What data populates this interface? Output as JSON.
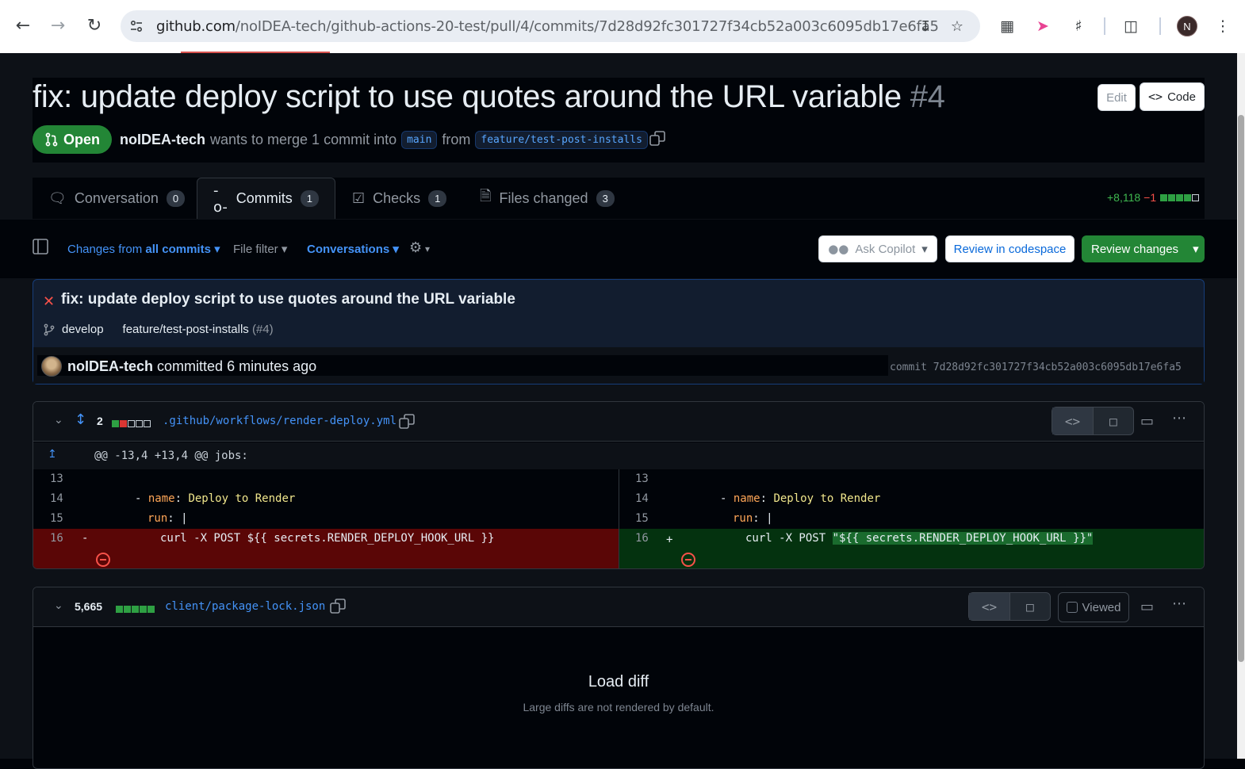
{
  "browser": {
    "url_host": "github.com",
    "url_path": "/noIDEA-tech/github-actions-20-test/pull/4/commits/7d28d92fc301727f34cb52a003c6095db17e6fa5",
    "profile_initial": "N"
  },
  "pr": {
    "title": "fix: update deploy script to use quotes around the URL variable",
    "number": "#4",
    "edit_label": "Edit",
    "code_label": "Code",
    "state": "Open",
    "author": "noIDEA-tech",
    "merge_text": "wants to merge 1 commit into",
    "base_branch": "main",
    "from_text": "from",
    "head_branch": "feature/test-post-installs"
  },
  "tabs": [
    {
      "label": "Conversation",
      "count": "0",
      "icon": "comment-discussion-icon"
    },
    {
      "label": "Commits",
      "count": "1",
      "icon": "git-commit-icon"
    },
    {
      "label": "Checks",
      "count": "1",
      "icon": "checklist-icon"
    },
    {
      "label": "Files changed",
      "count": "3",
      "icon": "file-diff-icon"
    }
  ],
  "diffstat": {
    "additions": "+8,118",
    "deletions": "−1"
  },
  "toolbar": {
    "changes_from": "Changes from",
    "all_commits": "all commits",
    "file_filter": "File filter",
    "conversations": "Conversations",
    "ask_copilot": "Ask Copilot",
    "review_codespace": "Review in codespace",
    "review_changes": "Review changes"
  },
  "commit": {
    "title": "fix: update deploy script to use quotes around the URL variable",
    "branch1": "develop",
    "branch2": "feature/test-post-installs",
    "pr_ref": "(#4)",
    "author": "noIDEA-tech",
    "committed": "committed",
    "time": "6 minutes ago",
    "sha_label": "commit 7d28d92fc301727f34cb52a003c6095db17e6fa5"
  },
  "file1": {
    "count": "2",
    "path": ".github/workflows/render-deploy.yml",
    "hunk": "@@ -13,4 +13,4 @@ jobs:",
    "left": {
      "lines": [
        "13",
        "14",
        "15",
        "16"
      ],
      "dash": "-",
      "name_key": "name",
      "name_val": "Deploy to Render",
      "run_key": "run",
      "pipe": "|",
      "del_sign": "-",
      "del_code": "curl -X POST ${{ secrets.RENDER_DEPLOY_HOOK_URL }}"
    },
    "right": {
      "lines": [
        "13",
        "14",
        "15",
        "16"
      ],
      "add_sign": "+",
      "add_code_prefix": "curl -X POST ",
      "add_code_str": "\"${{ secrets.RENDER_DEPLOY_HOOK_URL }}\""
    }
  },
  "file2": {
    "count": "5,665",
    "path": "client/package-lock.json",
    "viewed_label": "Viewed",
    "load_title": "Load diff",
    "load_sub": "Large diffs are not rendered by default."
  }
}
